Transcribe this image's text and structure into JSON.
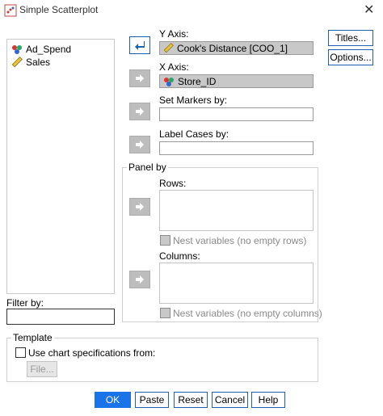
{
  "window": {
    "title": "Simple Scatterplot"
  },
  "variables": [
    {
      "label": "Ad_Spend",
      "icon": "nominal-icon"
    },
    {
      "label": "Sales",
      "icon": "scale-icon"
    }
  ],
  "yaxis": {
    "label": "Y Axis:",
    "value": "Cook's Distance [COO_1]"
  },
  "xaxis": {
    "label": "X Axis:",
    "value": "Store_ID"
  },
  "markers": {
    "label": "Set Markers by:"
  },
  "labelcases": {
    "label": "Label Cases by:"
  },
  "panel": {
    "title": "Panel by",
    "rows_label": "Rows:",
    "nest_rows": "Nest variables (no empty rows)",
    "columns_label": "Columns:",
    "nest_columns": "Nest variables (no empty columns)"
  },
  "filter": {
    "label": "Filter by:"
  },
  "template": {
    "title": "Template",
    "use_label": "Use chart specifications from:",
    "file_button": "File..."
  },
  "side_buttons": {
    "titles": "Titles...",
    "options": "Options..."
  },
  "footer": {
    "ok": "OK",
    "paste": "Paste",
    "reset": "Reset",
    "cancel": "Cancel",
    "help": "Help"
  }
}
